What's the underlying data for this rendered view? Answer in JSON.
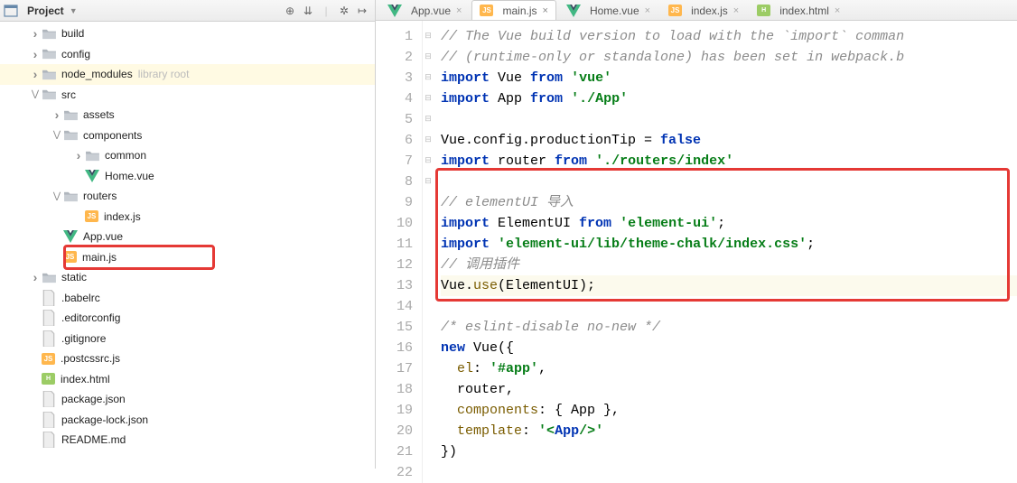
{
  "project": {
    "panel_title": "Project",
    "tree": [
      {
        "depth": 1,
        "arrow": "right",
        "icon": "folder",
        "label": "build"
      },
      {
        "depth": 1,
        "arrow": "right",
        "icon": "folder",
        "label": "config"
      },
      {
        "depth": 1,
        "arrow": "right",
        "icon": "folder",
        "label": "node_modules",
        "hint": "library root",
        "hl": "yellow"
      },
      {
        "depth": 1,
        "arrow": "down",
        "icon": "folder",
        "label": "src"
      },
      {
        "depth": 2,
        "arrow": "right",
        "icon": "folder",
        "label": "assets"
      },
      {
        "depth": 2,
        "arrow": "down",
        "icon": "folder",
        "label": "components"
      },
      {
        "depth": 3,
        "arrow": "right",
        "icon": "folder",
        "label": "common"
      },
      {
        "depth": 3,
        "arrow": "none",
        "icon": "vue",
        "label": "Home.vue"
      },
      {
        "depth": 2,
        "arrow": "down",
        "icon": "folder",
        "label": "routers"
      },
      {
        "depth": 3,
        "arrow": "none",
        "icon": "js",
        "label": "index.js"
      },
      {
        "depth": 2,
        "arrow": "none",
        "icon": "vue",
        "label": "App.vue"
      },
      {
        "depth": 2,
        "arrow": "none",
        "icon": "js",
        "label": "main.js",
        "selected": true,
        "redbox": true
      },
      {
        "depth": 1,
        "arrow": "right",
        "icon": "folder",
        "label": "static"
      },
      {
        "depth": 1,
        "arrow": "none",
        "icon": "file",
        "label": ".babelrc"
      },
      {
        "depth": 1,
        "arrow": "none",
        "icon": "file",
        "label": ".editorconfig"
      },
      {
        "depth": 1,
        "arrow": "none",
        "icon": "file",
        "label": ".gitignore"
      },
      {
        "depth": 1,
        "arrow": "none",
        "icon": "js",
        "label": ".postcssrc.js"
      },
      {
        "depth": 1,
        "arrow": "none",
        "icon": "html",
        "label": "index.html"
      },
      {
        "depth": 1,
        "arrow": "none",
        "icon": "file",
        "label": "package.json"
      },
      {
        "depth": 1,
        "arrow": "none",
        "icon": "file",
        "label": "package-lock.json"
      },
      {
        "depth": 1,
        "arrow": "none",
        "icon": "file",
        "label": "README.md"
      }
    ]
  },
  "tabs": [
    {
      "icon": "vue",
      "label": "App.vue",
      "close": true
    },
    {
      "icon": "js",
      "label": "main.js",
      "close": true,
      "active": true
    },
    {
      "icon": "vue",
      "label": "Home.vue",
      "close": true
    },
    {
      "icon": "js",
      "label": "index.js",
      "close": true
    },
    {
      "icon": "html",
      "label": "index.html",
      "close": true
    }
  ],
  "editor": {
    "line_start": 1,
    "line_end": 22,
    "current_line": 13,
    "code": [
      {
        "n": 1,
        "fold": "",
        "html": "<span class='c-cmt'>// The Vue build version to load with the `import` comman</span>"
      },
      {
        "n": 2,
        "fold": "",
        "html": "<span class='c-cmt'>// (runtime-only or standalone) has been set in webpack.b</span>"
      },
      {
        "n": 3,
        "fold": "-",
        "html": "<span class='c-kw'>import</span> Vue <span class='c-kw'>from</span> <span class='c-str'>'vue'</span>"
      },
      {
        "n": 4,
        "fold": "-",
        "html": "<span class='c-kw'>import</span> App <span class='c-kw'>from</span> <span class='c-str'>'./App'</span>"
      },
      {
        "n": 5,
        "fold": "",
        "html": ""
      },
      {
        "n": 6,
        "fold": "",
        "html": "Vue.config.productionTip = <span class='c-bool'>false</span>"
      },
      {
        "n": 7,
        "fold": "-",
        "html": "<span class='c-kw'>import</span> router <span class='c-kw'>from</span> <span class='c-str'>'./routers/index'</span>"
      },
      {
        "n": 8,
        "fold": "",
        "html": ""
      },
      {
        "n": 9,
        "fold": "-",
        "html": "<span class='c-cmt'>// elementUI 导入</span>"
      },
      {
        "n": 10,
        "fold": "-",
        "html": "<span class='c-kw'>import</span> ElementUI <span class='c-kw'>from</span> <span class='c-str'>'element-ui'</span>;"
      },
      {
        "n": 11,
        "fold": "-",
        "html": "<span class='c-kw'>import</span> <span class='c-str'>'element-ui/lib/theme-chalk/index.css'</span>;"
      },
      {
        "n": 12,
        "fold": "",
        "html": "<span class='c-cmt'>// 调用插件</span>"
      },
      {
        "n": 13,
        "fold": "",
        "hl": true,
        "html": "Vue.<span class='c-fn'>use</span>(ElementUI);"
      },
      {
        "n": 14,
        "fold": "",
        "html": ""
      },
      {
        "n": 15,
        "fold": "",
        "html": "<span class='c-cmt'>/* eslint-disable no-new */</span>"
      },
      {
        "n": 16,
        "fold": "-",
        "html": "<span class='c-kw'>new</span> Vue({"
      },
      {
        "n": 17,
        "fold": "",
        "html": "  <span class='c-fn'>el</span>: <span class='c-str'>'#app'</span>,"
      },
      {
        "n": 18,
        "fold": "",
        "html": "  router,"
      },
      {
        "n": 19,
        "fold": "",
        "html": "  <span class='c-fn'>components</span>: { App },"
      },
      {
        "n": 20,
        "fold": "",
        "html": "  <span class='c-fn'>template</span>: <span class='c-str'>'&lt;<span class='c-tag'>App</span>/&gt;'</span>"
      },
      {
        "n": 21,
        "fold": "-",
        "html": "})"
      },
      {
        "n": 22,
        "fold": "",
        "html": ""
      }
    ],
    "red_box_lines": {
      "from": 8,
      "to": 13
    }
  }
}
